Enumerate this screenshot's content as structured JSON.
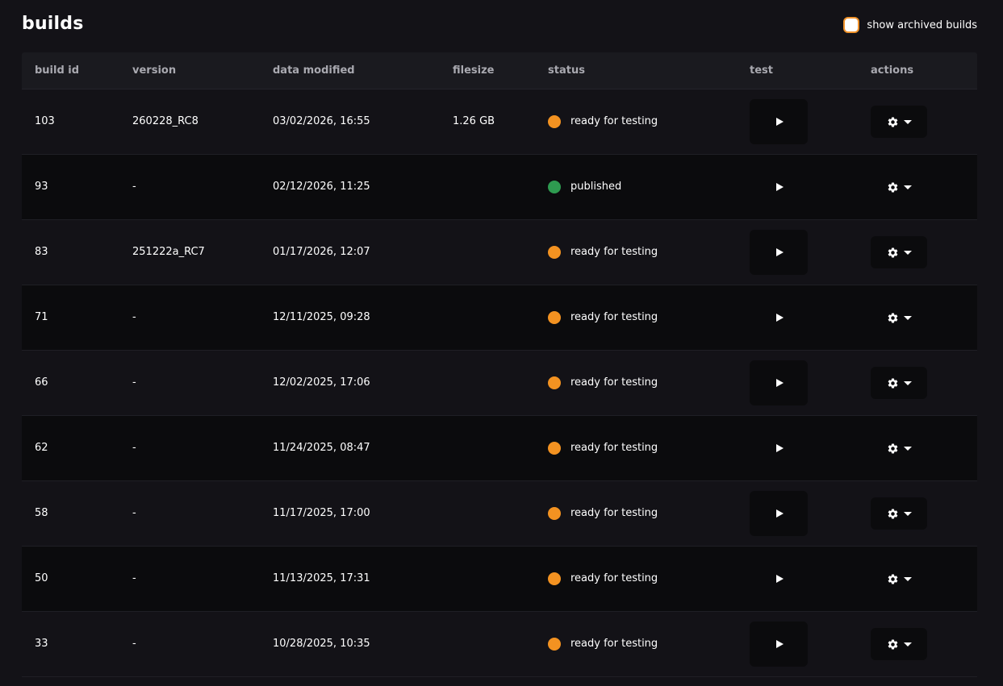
{
  "header": {
    "title": "builds",
    "archived_toggle_label": "show archived builds"
  },
  "columns": {
    "build_id": "build id",
    "version": "version",
    "date": "data modified",
    "filesize": "filesize",
    "status": "status",
    "test": "test",
    "actions": "actions"
  },
  "colors": {
    "ready": "#f39221",
    "published": "#2e9b50",
    "accent": "#f0922a"
  },
  "rows": [
    {
      "id": "103",
      "version": "260228_RC8",
      "date": "03/02/2026, 16:55",
      "size": "1.26 GB",
      "status": "ready for testing",
      "status_kind": "ready"
    },
    {
      "id": "93",
      "version": "-",
      "date": "02/12/2026, 11:25",
      "size": "",
      "status": "published",
      "status_kind": "published"
    },
    {
      "id": "83",
      "version": "251222a_RC7",
      "date": "01/17/2026, 12:07",
      "size": "",
      "status": "ready for testing",
      "status_kind": "ready"
    },
    {
      "id": "71",
      "version": "-",
      "date": "12/11/2025, 09:28",
      "size": "",
      "status": "ready for testing",
      "status_kind": "ready"
    },
    {
      "id": "66",
      "version": "-",
      "date": "12/02/2025, 17:06",
      "size": "",
      "status": "ready for testing",
      "status_kind": "ready"
    },
    {
      "id": "62",
      "version": "-",
      "date": "11/24/2025, 08:47",
      "size": "",
      "status": "ready for testing",
      "status_kind": "ready"
    },
    {
      "id": "58",
      "version": "-",
      "date": "11/17/2025, 17:00",
      "size": "",
      "status": "ready for testing",
      "status_kind": "ready"
    },
    {
      "id": "50",
      "version": "-",
      "date": "11/13/2025, 17:31",
      "size": "",
      "status": "ready for testing",
      "status_kind": "ready"
    },
    {
      "id": "33",
      "version": "-",
      "date": "10/28/2025, 10:35",
      "size": "",
      "status": "ready for testing",
      "status_kind": "ready"
    }
  ],
  "icons": {
    "test": "play-icon",
    "actions": [
      "gear-icon",
      "chevron-down-icon"
    ],
    "status": "status-dot-icon"
  }
}
